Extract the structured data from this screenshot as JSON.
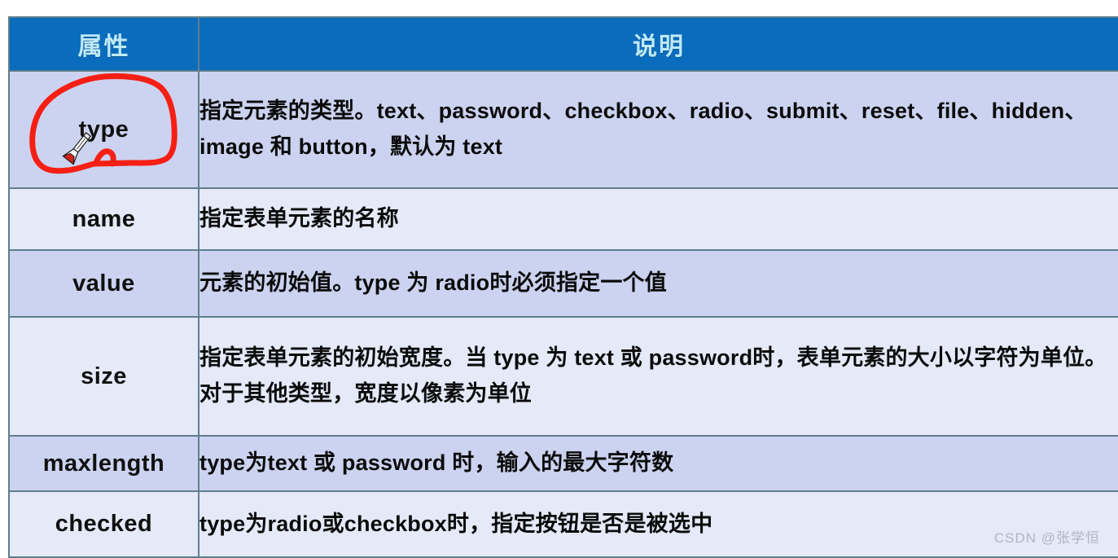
{
  "table": {
    "headers": {
      "attribute": "属性",
      "description": "说明"
    },
    "rows": [
      {
        "attribute": "type",
        "description": "指定元素的类型。text、password、checkbox、radio、submit、reset、file、hidden、image 和 button，默认为 text",
        "shade": "dark",
        "annotated": true
      },
      {
        "attribute": "name",
        "description": "指定表单元素的名称",
        "shade": "light",
        "annotated": false
      },
      {
        "attribute": "value",
        "description": "元素的初始值。type 为 radio时必须指定一个值",
        "shade": "dark",
        "annotated": false
      },
      {
        "attribute": "size",
        "description": "指定表单元素的初始宽度。当 type 为 text 或 password时，表单元素的大小以字符为单位。对于其他类型，宽度以像素为单位",
        "shade": "light",
        "annotated": false
      },
      {
        "attribute": "maxlength",
        "description": "type为text 或 password 时，输入的最大字符数",
        "shade": "dark",
        "annotated": false
      },
      {
        "attribute": "checked",
        "description": "type为radio或checkbox时，指定按钮是否是被选中",
        "shade": "light",
        "annotated": false
      }
    ]
  },
  "annotation": {
    "shape": "hand-drawn-circle",
    "color": "#f61f14",
    "target": "type"
  },
  "cursor": {
    "type": "pen-cursor"
  },
  "watermark": {
    "text": "CSDN @张学恒",
    "color": "#b0b4c4"
  },
  "colors": {
    "header_background": "#0a6cbd",
    "header_text": "#bfe9f5",
    "row_dark": "#ccd3f0",
    "row_light": "#e5e9f8",
    "border": "#5f7e8c",
    "body_text": "#0b0b0b",
    "annotation_red": "#f61f14"
  }
}
